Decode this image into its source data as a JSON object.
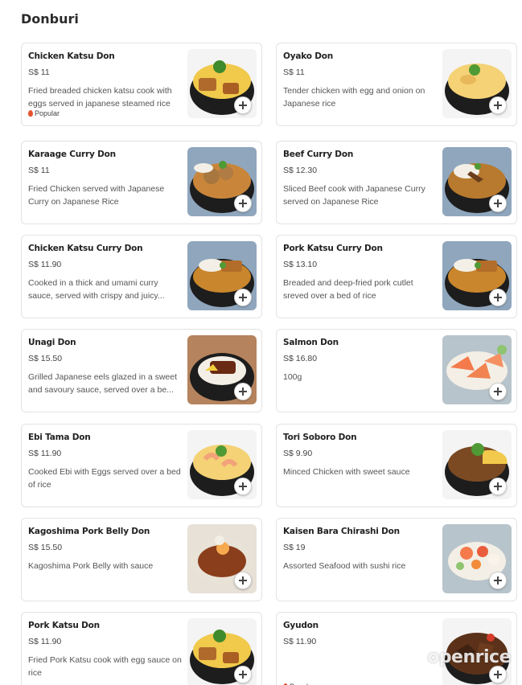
{
  "section": {
    "title": "Donburi"
  },
  "items": [
    {
      "name": "Chicken Katsu Don",
      "price": "S$ 11",
      "description": "Fried breaded chicken katsu cook with eggs served in japanese steamed rice",
      "badge": "Popular",
      "image": "katsu-egg-bowl"
    },
    {
      "name": "Oyako Don",
      "price": "S$ 11",
      "description": "Tender chicken with egg and onion on Japanese rice",
      "image": "oyako-bowl"
    },
    {
      "name": "Karaage Curry Don",
      "price": "S$ 11",
      "description": "Fried Chicken served with Japanese Curry on Japanese Rice",
      "image": "karaage-curry-bowl"
    },
    {
      "name": "Beef Curry Don",
      "price": "S$ 12.30",
      "description": "Sliced Beef cook with Japanese Curry served on Japanese Rice",
      "image": "beef-curry-bowl"
    },
    {
      "name": "Chicken Katsu Curry Don",
      "price": "S$ 11.90",
      "description": "Cooked in a thick and umami curry sauce, served with crispy and juicy...",
      "image": "katsu-curry-bowl"
    },
    {
      "name": "Pork Katsu Curry Don",
      "price": "S$ 13.10",
      "description": "Breaded and deep-fried pork cutlet sreved over a bed of rice",
      "image": "katsu-curry-bowl"
    },
    {
      "name": "Unagi Don",
      "price": "S$ 15.50",
      "description": "Grilled Japanese eels glazed in a sweet and savoury sauce, served over a be...",
      "image": "unagi-bowl"
    },
    {
      "name": "Salmon Don",
      "price": "S$ 16.80",
      "description": "100g",
      "image": "salmon-bowl"
    },
    {
      "name": "Ebi Tama Don",
      "price": "S$ 11.90",
      "description": "Cooked Ebi with Eggs served over a bed of rice",
      "image": "ebi-egg-bowl"
    },
    {
      "name": "Tori Soboro Don",
      "price": "S$ 9.90",
      "description": "Minced Chicken with sweet sauce",
      "image": "soboro-bowl"
    },
    {
      "name": "Kagoshima Pork Belly Don",
      "price": "S$ 15.50",
      "description": "Kagoshima Pork Belly with sauce",
      "image": "pork-belly-bowl"
    },
    {
      "name": "Kaisen Bara Chirashi Don",
      "price": "S$ 19",
      "description": "Assorted Seafood with sushi rice",
      "image": "chirashi-bowl"
    },
    {
      "name": "Pork Katsu Don",
      "price": "S$ 11.90",
      "description": "Fried Pork Katsu cook with egg sauce on rice",
      "image": "katsu-egg-bowl"
    },
    {
      "name": "Gyudon",
      "price": "S$ 11.90",
      "description": "",
      "badge": "Popular",
      "image": "gyudon-bowl"
    }
  ],
  "watermark": "openrice",
  "colors": {
    "accent": "#e5532e",
    "border": "#e3e3e3"
  }
}
